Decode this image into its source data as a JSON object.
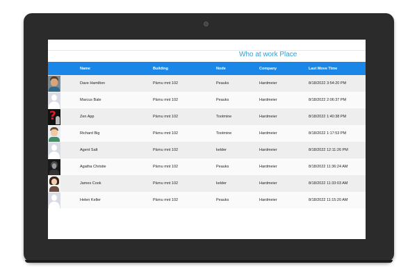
{
  "page": {
    "title": "Who at work Place"
  },
  "table": {
    "columns": [
      "Name",
      "Building",
      "Node",
      "Company",
      "Last Move Time"
    ],
    "rows": [
      {
        "avatar": "person-photo",
        "name": "Dave Hamilton",
        "building": "Pärnu mnt 102",
        "node": "Peauks",
        "company": "Hardmeier",
        "time": "8/18/2022 3:54:20 PM"
      },
      {
        "avatar": "generic-user",
        "name": "Marcus Bale",
        "building": "Pärnu mnt 102",
        "node": "Peauks",
        "company": "Hardmeier",
        "time": "8/18/2022 2:06:37 PM"
      },
      {
        "avatar": "question-mark",
        "name": "Zen App",
        "building": "Pärnu mnt 102",
        "node": "Tootmine",
        "company": "Hardmeier",
        "time": "8/18/2022 1:40:38 PM"
      },
      {
        "avatar": "person-photo",
        "name": "Richard Big",
        "building": "Pärnu mnt 102",
        "node": "Tootmine",
        "company": "Hardmeier",
        "time": "8/18/2022 1:17:53 PM"
      },
      {
        "avatar": "generic-user",
        "name": "Agent Salt",
        "building": "Pärnu mnt 102",
        "node": "kelder",
        "company": "Hardmeier",
        "time": "8/18/2022 12:11:26 PM"
      },
      {
        "avatar": "person-photo",
        "name": "Agatha Christie",
        "building": "Pärnu mnt 102",
        "node": "Peauks",
        "company": "Hardmeier",
        "time": "8/18/2022 11:36:24 AM"
      },
      {
        "avatar": "person-photo",
        "name": "James Cook",
        "building": "Pärnu mnt 102",
        "node": "kelder",
        "company": "Hardmeier",
        "time": "8/18/2022 11:33:03 AM"
      },
      {
        "avatar": "generic-user",
        "name": "Helen Keller",
        "building": "Pärnu mnt 102",
        "node": "Peauks",
        "company": "Hardmeier",
        "time": "8/18/2022 11:15:20 AM"
      }
    ]
  },
  "colors": {
    "header_bg": "#1a86e8",
    "title": "#2d9fd8",
    "device": "#2b2b2b"
  }
}
